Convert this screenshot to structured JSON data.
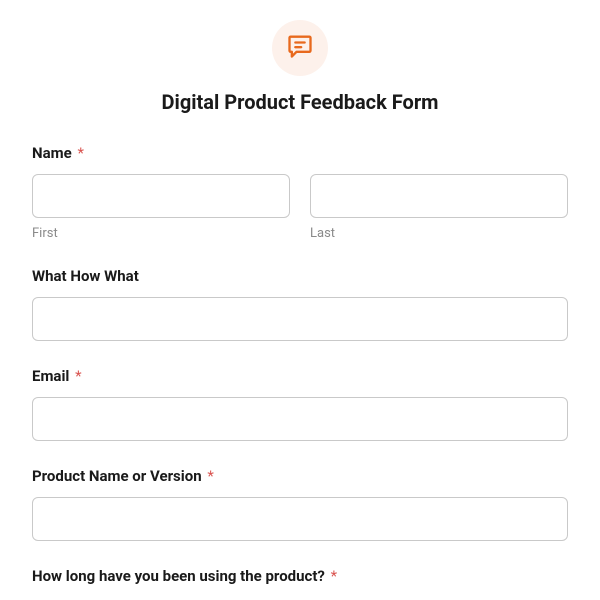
{
  "form": {
    "title": "Digital Product Feedback Form",
    "icon": "chat-icon",
    "required_marker": "*",
    "fields": {
      "name": {
        "label": "Name",
        "required": true,
        "first_sublabel": "First",
        "last_sublabel": "Last"
      },
      "what": {
        "label": "What How What",
        "required": false
      },
      "email": {
        "label": "Email",
        "required": true
      },
      "product": {
        "label": "Product Name or Version",
        "required": true
      },
      "duration": {
        "label": "How long have you been using the product?",
        "required": true
      }
    }
  },
  "colors": {
    "accent": "#e8691d",
    "icon_bg": "#fdf1eb",
    "required": "#d9534f",
    "border": "#c9c9c9",
    "sublabel": "#8a8a8a"
  }
}
